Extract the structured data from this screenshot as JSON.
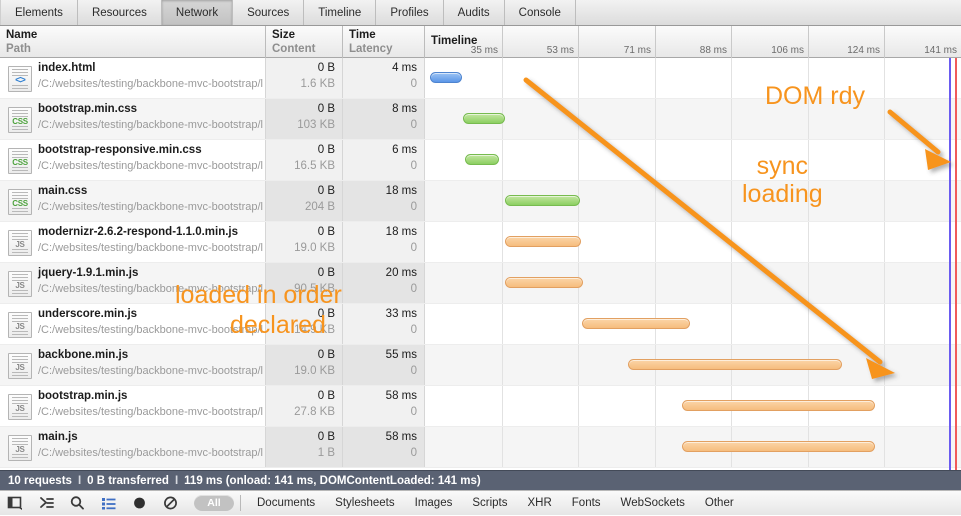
{
  "tabs": [
    {
      "label": "Elements",
      "selected": false
    },
    {
      "label": "Resources",
      "selected": false
    },
    {
      "label": "Network",
      "selected": true
    },
    {
      "label": "Sources",
      "selected": false
    },
    {
      "label": "Timeline",
      "selected": false
    },
    {
      "label": "Profiles",
      "selected": false
    },
    {
      "label": "Audits",
      "selected": false
    },
    {
      "label": "Console",
      "selected": false
    }
  ],
  "columns": {
    "name": {
      "primary": "Name",
      "secondary": "Path"
    },
    "size": {
      "primary": "Size",
      "secondary": "Content"
    },
    "time": {
      "primary": "Time",
      "secondary": "Latency"
    },
    "timeline": {
      "primary": "Timeline"
    }
  },
  "timeline_ruler": {
    "ticks": [
      "35 ms",
      "53 ms",
      "71 ms",
      "88 ms",
      "106 ms",
      "124 ms",
      "141 ms"
    ],
    "max_ms": 141
  },
  "requests": [
    {
      "name": "index.html",
      "path": "/C:/websites/testing/backbone-mvc-bootstrap/l",
      "size": "0 B",
      "content": "1.6 KB",
      "time": "4 ms",
      "latency": "0",
      "icon": "html-file-icon",
      "bar_color": "#5b96e8",
      "bar_start_pct": 0.9,
      "bar_end_pct": 6.9
    },
    {
      "name": "bootstrap.min.css",
      "path": "/C:/websites/testing/backbone-mvc-bootstrap/l",
      "size": "0 B",
      "content": "103 KB",
      "time": "8 ms",
      "latency": "0",
      "icon": "css-file-icon",
      "bar_color": "#8ccf62",
      "bar_start_pct": 7.1,
      "bar_end_pct": 15.0
    },
    {
      "name": "bootstrap-responsive.min.css",
      "path": "/C:/websites/testing/backbone-mvc-bootstrap/l",
      "size": "0 B",
      "content": "16.5 KB",
      "time": "6 ms",
      "latency": "0",
      "icon": "css-file-icon",
      "bar_color": "#8ccf62",
      "bar_start_pct": 7.5,
      "bar_end_pct": 13.8
    },
    {
      "name": "main.css",
      "path": "/C:/websites/testing/backbone-mvc-bootstrap/l",
      "size": "0 B",
      "content": "204 B",
      "time": "18 ms",
      "latency": "0",
      "icon": "css-file-icon",
      "bar_color": "#8ccf62",
      "bar_start_pct": 14.9,
      "bar_end_pct": 29.0
    },
    {
      "name": "modernizr-2.6.2-respond-1.1.0.min.js",
      "path": "/C:/websites/testing/backbone-mvc-bootstrap/l",
      "size": "0 B",
      "content": "19.0 KB",
      "time": "18 ms",
      "latency": "0",
      "icon": "js-file-icon",
      "bar_color": "#f6bd7e",
      "bar_start_pct": 14.9,
      "bar_end_pct": 29.2
    },
    {
      "name": "jquery-1.9.1.min.js",
      "path": "/C:/websites/testing/backbone-mvc-bootstrap/l",
      "size": "0 B",
      "content": "90.5 KB",
      "time": "20 ms",
      "latency": "0",
      "icon": "js-file-icon",
      "bar_color": "#f6bd7e",
      "bar_start_pct": 14.9,
      "bar_end_pct": 29.4
    },
    {
      "name": "underscore.min.js",
      "path": "/C:/websites/testing/backbone-mvc-bootstrap/l",
      "size": "0 B",
      "content": "14.9 KB",
      "time": "33 ms",
      "latency": "0",
      "icon": "js-file-icon",
      "bar_color": "#f6bd7e",
      "bar_start_pct": 29.3,
      "bar_end_pct": 49.5
    },
    {
      "name": "backbone.min.js",
      "path": "/C:/websites/testing/backbone-mvc-bootstrap/l",
      "size": "0 B",
      "content": "19.0 KB",
      "time": "55 ms",
      "latency": "0",
      "icon": "js-file-icon",
      "bar_color": "#f6bd7e",
      "bar_start_pct": 37.9,
      "bar_end_pct": 77.8
    },
    {
      "name": "bootstrap.min.js",
      "path": "/C:/websites/testing/backbone-mvc-bootstrap/l",
      "size": "0 B",
      "content": "27.8 KB",
      "time": "58 ms",
      "latency": "0",
      "icon": "js-file-icon",
      "bar_color": "#f6bd7e",
      "bar_start_pct": 48.0,
      "bar_end_pct": 84.0
    },
    {
      "name": "main.js",
      "path": "/C:/websites/testing/backbone-mvc-bootstrap/l",
      "size": "0 B",
      "content": "1 B",
      "time": "58 ms",
      "latency": "0",
      "icon": "js-file-icon",
      "bar_color": "#f6bd7e",
      "bar_start_pct": 48.0,
      "bar_end_pct": 84.0
    }
  ],
  "markers": {
    "dom_content_loaded_color": "#6a5bf0",
    "onload_color": "#f05b5b"
  },
  "annotations": [
    {
      "id": "dom-ready",
      "text": "DOM rdy"
    },
    {
      "id": "sync-loading-line1",
      "text": "sync"
    },
    {
      "id": "sync-loading-line2",
      "text": "loading"
    },
    {
      "id": "load-order-line1",
      "text": "loaded in order"
    },
    {
      "id": "load-order-line2",
      "text": "declared"
    }
  ],
  "annotation_color": "#F7941E",
  "status": {
    "requests": "10 requests",
    "transferred": "0 B transferred",
    "timing": "119 ms (onload: 141 ms, DOMContentLoaded: 141 ms)",
    "separator": "I"
  },
  "bottom_toolbar": {
    "icons": [
      {
        "name": "dock-panel-icon"
      },
      {
        "name": "console-drawer-icon"
      },
      {
        "name": "search-icon"
      },
      {
        "name": "filter-list-icon"
      },
      {
        "name": "record-icon"
      },
      {
        "name": "clear-icon"
      }
    ],
    "all_filter": "All",
    "filters": [
      "Documents",
      "Stylesheets",
      "Images",
      "Scripts",
      "XHR",
      "Fonts",
      "WebSockets",
      "Other"
    ]
  }
}
